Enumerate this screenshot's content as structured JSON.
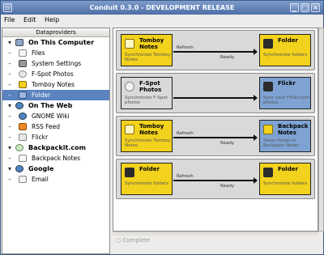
{
  "window": {
    "title": "Conduit 0.3.0 - DEVELOPMENT RELEASE"
  },
  "menu": {
    "file": "File",
    "edit": "Edit",
    "help": "Help"
  },
  "sidebar": {
    "header": "Dataproviders",
    "categories": [
      {
        "label": "On This Computer",
        "items": [
          "Files",
          "System Settings",
          "F-Spot Photos",
          "Tomboy Notes",
          "Folder"
        ]
      },
      {
        "label": "On The Web",
        "items": [
          "GNOME Wiki",
          "RSS Feed",
          "Flickr"
        ]
      },
      {
        "label": "Backpackit.com",
        "items": [
          "Backpack Notes"
        ]
      },
      {
        "label": "Google",
        "items": [
          "Email"
        ]
      }
    ]
  },
  "conduits": [
    {
      "source": {
        "name": "Tomboy Notes",
        "desc": "Synchronize Tomboy Notes"
      },
      "sink": {
        "name": "Folder",
        "desc": "Synchronize folders"
      },
      "label_top": "Refresh",
      "label_bottom": "Ready"
    },
    {
      "source": {
        "name": "F-Spot Photos",
        "desc": "Synchronize F-Spot photos"
      },
      "sink": {
        "name": "Flickr",
        "desc": "Sync your Flickr.com photos"
      },
      "label_top": "",
      "label_bottom": ""
    },
    {
      "source": {
        "name": "Tomboy Notes",
        "desc": "Synchronize Tomboy Notes"
      },
      "sink": {
        "name": "Backpack Notes",
        "desc": "Store things in Backpack Notes"
      },
      "label_top": "Refresh",
      "label_bottom": "Ready"
    },
    {
      "source": {
        "name": "Folder",
        "desc": "Synchronize folders"
      },
      "sink": {
        "name": "Folder",
        "desc": "Synchronize folders"
      },
      "label_top": "Refresh",
      "label_bottom": "Ready"
    }
  ],
  "status": "Complete",
  "colors": {
    "titlebar": "#5a7db5",
    "selection": "#5a83c0",
    "tomboy": "#f2d21c",
    "fspot": "#d9d9d9",
    "flickr": "#7ea3d3"
  }
}
